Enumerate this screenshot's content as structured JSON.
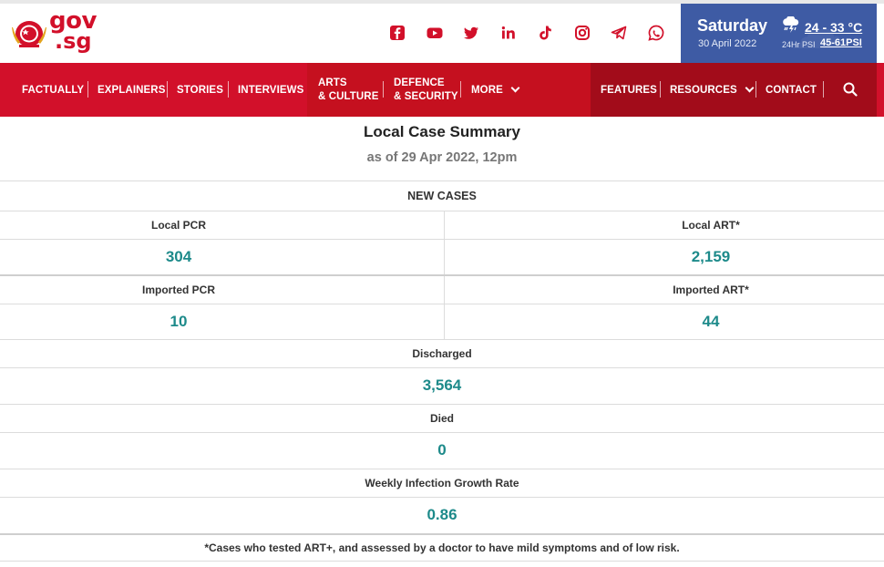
{
  "header": {
    "logo": {
      "line1": "gov",
      "line2": ".sg"
    },
    "social_icons": [
      "facebook-icon",
      "youtube-icon",
      "twitter-icon",
      "linkedin-icon",
      "tiktok-icon",
      "instagram-icon",
      "telegram-icon",
      "whatsapp-icon"
    ],
    "weather": {
      "day": "Saturday",
      "date": "30 April 2022",
      "icon": "thunder-rain-icon",
      "temperature": "24 - 33 °C",
      "psi_label": "24Hr PSI",
      "psi_value": "45-61PSI"
    }
  },
  "nav": {
    "items": [
      {
        "label": "FACTUALLY"
      },
      {
        "label": "EXPLAINERS"
      },
      {
        "label": "STORIES"
      },
      {
        "label": "INTERVIEWS"
      },
      {
        "line1": "ARTS",
        "line2": "& CULTURE"
      },
      {
        "line1": "DEFENCE",
        "line2": "& SECURITY"
      },
      {
        "label": "MORE"
      },
      {
        "label": "FEATURES"
      },
      {
        "label": "RESOURCES"
      },
      {
        "label": "CONTACT"
      }
    ]
  },
  "summary": {
    "title": "Local Case Summary",
    "subtitle": "as of 29 Apr 2022, 12pm",
    "section_label": "NEW CASES",
    "local_pcr": {
      "label": "Local PCR",
      "value": "304"
    },
    "local_art": {
      "label": "Local ART*",
      "value": "2,159"
    },
    "imported_pcr": {
      "label": "Imported PCR",
      "value": "10"
    },
    "imported_art": {
      "label": "Imported ART*",
      "value": "44"
    },
    "discharged": {
      "label": "Discharged",
      "value": "3,564"
    },
    "died": {
      "label": "Died",
      "value": "0"
    },
    "weekly_growth": {
      "label": "Weekly Infection Growth Rate",
      "value": "0.86"
    },
    "footnote": "*Cases who tested ART+, and assessed by a doctor to have mild symptoms and of low risk."
  },
  "colors": {
    "brand_red": "#d2102a",
    "nav_dark": "#a20c1a",
    "weather_blue": "#3e5ba4",
    "value_teal": "#1d8a8a"
  }
}
